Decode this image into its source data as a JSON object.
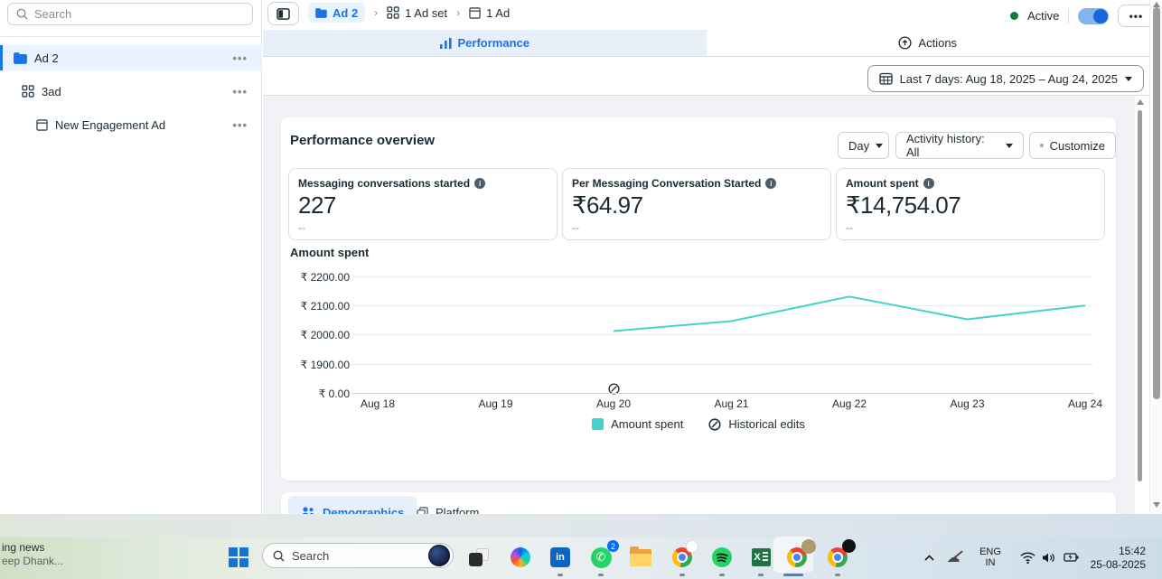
{
  "colors": {
    "accent_blue": "#1b74e4",
    "selected_bg": "#e7f3ff",
    "tab_bg": "#e7f0fa",
    "teal_line": "#42d4c8",
    "active_green": "#0f7b3f",
    "content_bg": "#f0f2f5",
    "text_dark": "#1c2b33",
    "text_gray": "#8a8d91"
  },
  "sidebar": {
    "search_placeholder": "Search",
    "items": [
      {
        "label": "Ad 2",
        "icon": "folder",
        "menu": "•••",
        "selected": true
      },
      {
        "label": "3ad",
        "icon": "ad-set-grid",
        "menu": "•••",
        "selected": false
      },
      {
        "label": "New Engagement Ad",
        "icon": "ad-window",
        "menu": "•••",
        "selected": false
      }
    ]
  },
  "header": {
    "breadcrumb": [
      {
        "label": "Ad 2",
        "icon": "folder"
      },
      {
        "label": "1 Ad set",
        "icon": "ad-set-grid"
      },
      {
        "label": "1 Ad",
        "icon": "ad-window"
      }
    ],
    "separator": "›",
    "status": {
      "label": "Active",
      "toggle_on": true
    },
    "menu_button": "•••"
  },
  "tabs": {
    "performance": {
      "label": "Performance",
      "active": true
    },
    "actions": {
      "label": "Actions",
      "active": false
    }
  },
  "date_filter": {
    "label": "Last 7 days: Aug 18, 2025 – Aug 24, 2025"
  },
  "overview": {
    "title": "Performance overview",
    "day_button": "Day",
    "activity_button": "Activity history: All",
    "customize_button": "Customize",
    "metrics": [
      {
        "label": "Messaging conversations started",
        "value": "227",
        "sub": "--"
      },
      {
        "label": "Per Messaging Conversation Started",
        "value": "₹64.97",
        "sub": "--"
      },
      {
        "label": "Amount spent",
        "value": "₹14,754.07",
        "sub": "--"
      }
    ]
  },
  "chart_data": {
    "type": "line",
    "title": "Amount spent",
    "x_categories": [
      "Aug 18",
      "Aug 19",
      "Aug 20",
      "Aug 21",
      "Aug 22",
      "Aug 23",
      "Aug 24"
    ],
    "y_tick_labels": [
      "₹ 2200.00",
      "₹ 2100.00",
      "₹ 2000.00",
      "₹ 1900.00",
      "₹ 0.00"
    ],
    "y_tick_values": [
      2200,
      2100,
      2000,
      1900,
      0
    ],
    "axis_break": true,
    "grid": true,
    "legend": [
      "Amount spent",
      "Historical edits"
    ],
    "legend_position": "bottom",
    "historical_edit_marker_x": "Aug 20",
    "series": [
      {
        "name": "Amount spent",
        "color": "#42d4c8",
        "points": [
          {
            "x": "Aug 20",
            "y": 2013
          },
          {
            "x": "Aug 21",
            "y": 2047
          },
          {
            "x": "Aug 22",
            "y": 2131
          },
          {
            "x": "Aug 23",
            "y": 2053
          },
          {
            "x": "Aug 24",
            "y": 2100
          }
        ]
      }
    ]
  },
  "bottom_tabs": {
    "demographics": {
      "label": "Demographics",
      "active": true
    },
    "platform": {
      "label": "Platform",
      "active": false
    }
  },
  "taskbar": {
    "widget_line1": "ing news",
    "widget_line2": "eep Dhank...",
    "search_placeholder": "Search",
    "whatsapp_badge": "2",
    "linkedin_label": "in",
    "excel_label": "X",
    "tray": {
      "lang_line1": "ENG",
      "lang_line2": "IN",
      "time": "15:42",
      "date": "25-08-2025"
    }
  }
}
